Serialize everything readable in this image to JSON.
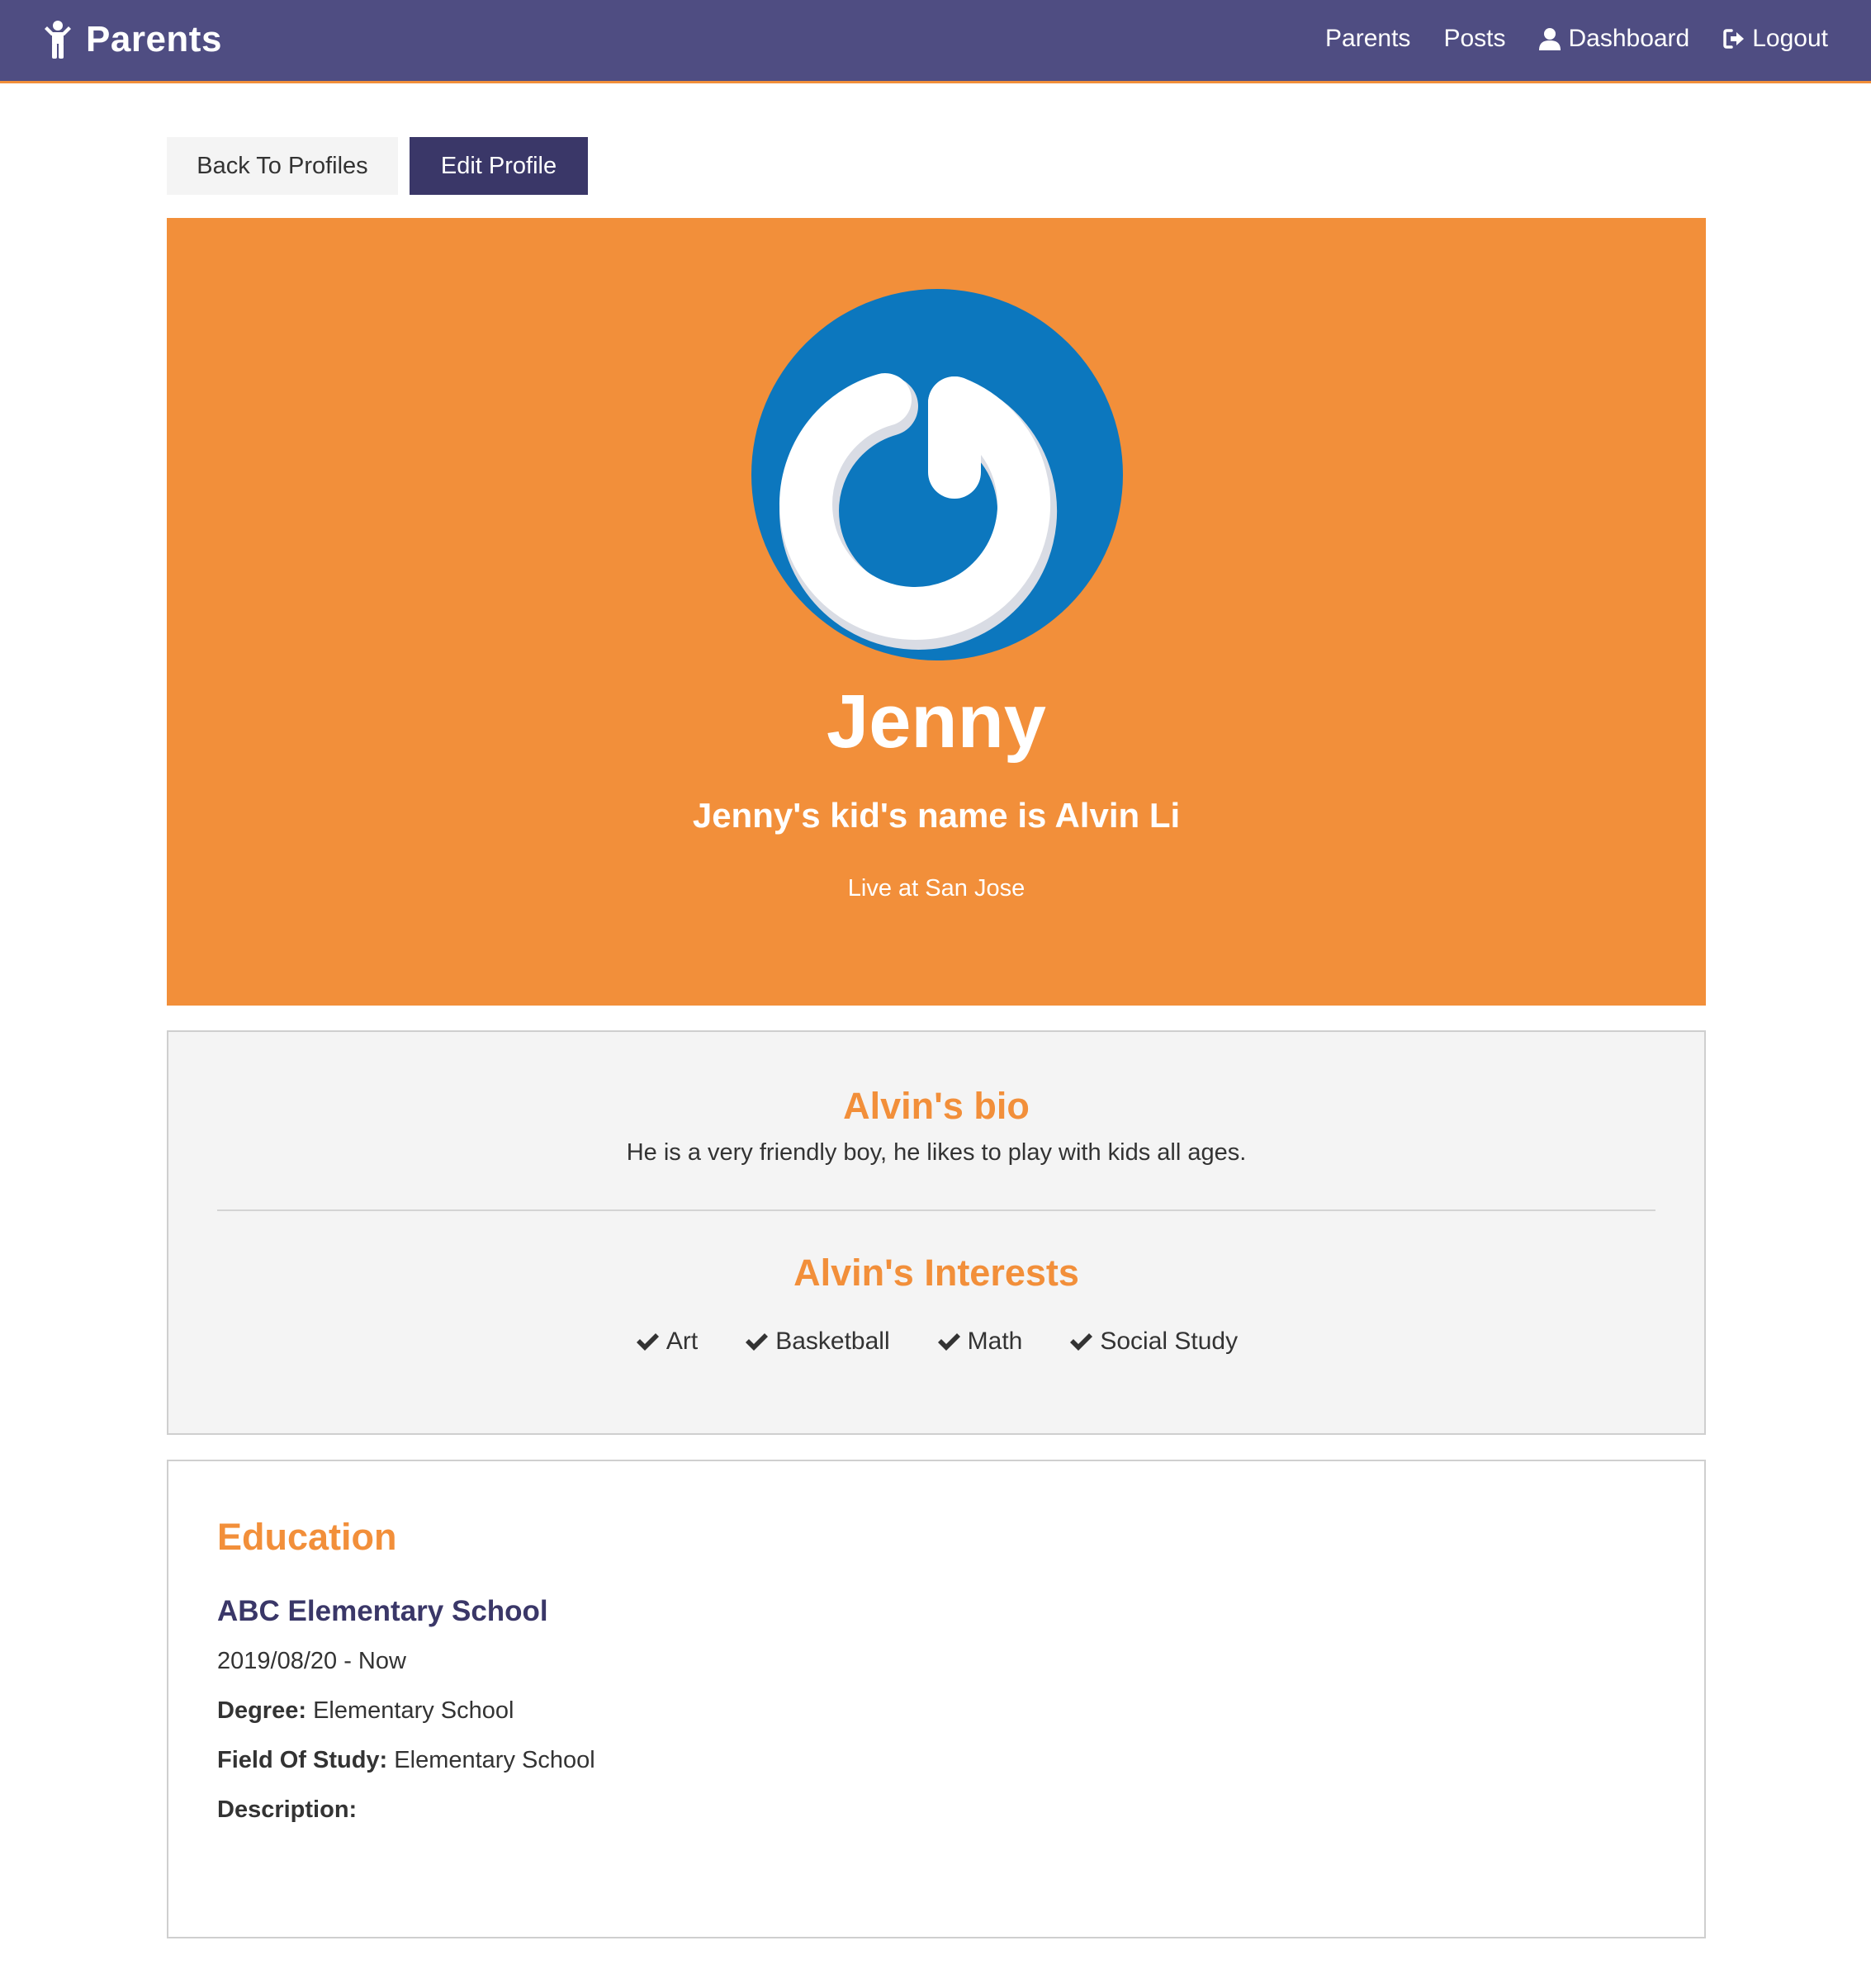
{
  "navbar": {
    "brand": "Parents",
    "links": [
      {
        "label": "Parents",
        "icon": ""
      },
      {
        "label": "Posts",
        "icon": ""
      },
      {
        "label": "Dashboard",
        "icon": "user-icon"
      },
      {
        "label": "Logout",
        "icon": "logout-icon"
      }
    ],
    "background": "#4f4d82"
  },
  "actions": {
    "back_label": "Back To Profiles",
    "edit_label": "Edit Profile"
  },
  "profile": {
    "name": "Jenny",
    "subtitle": "Jenny's kid's name is Alvin Li",
    "location": "Live at San Jose",
    "accent": "#f28f3a"
  },
  "bio": {
    "title": "Alvin's bio",
    "text": "He is a very friendly boy, he likes to play with kids all ages."
  },
  "interests": {
    "title": "Alvin's Interests",
    "items": [
      "Art",
      "Basketball",
      "Math",
      "Social Study"
    ]
  },
  "education": {
    "title": "Education",
    "school": "ABC Elementary School",
    "dates": "2019/08/20 - Now",
    "degree_label": "Degree:",
    "degree": "Elementary School",
    "field_label": "Field Of Study:",
    "field": "Elementary School",
    "description_label": "Description:",
    "description": ""
  }
}
